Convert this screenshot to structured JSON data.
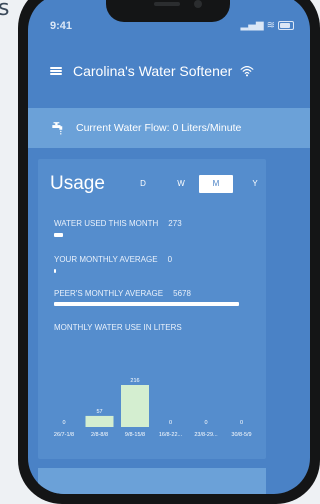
{
  "corner_glyph": "s",
  "status": {
    "time": "9:41"
  },
  "header": {
    "title": "Carolina's Water Softener"
  },
  "flow": {
    "text": "Current Water Flow: 0 Liters/Minute"
  },
  "usage": {
    "title": "Usage",
    "tabs": [
      {
        "label": "D",
        "active": false
      },
      {
        "label": "W",
        "active": false
      },
      {
        "label": "M",
        "active": true
      },
      {
        "label": "Y",
        "active": false
      }
    ],
    "stats": [
      {
        "label": "WATER USED THIS MONTH",
        "value": "273",
        "fraction": 0.05
      },
      {
        "label": "YOUR MONTHLY AVERAGE",
        "value": "0",
        "fraction": 0.0
      },
      {
        "label": "PEER'S MONTHLY AVERAGE",
        "value": "5678",
        "fraction": 1.0
      }
    ],
    "chart_heading": "MONTHLY WATER USE IN LITERS"
  },
  "chart_data": {
    "type": "bar",
    "title": "MONTHLY WATER USE IN LITERS",
    "categories": [
      "26/7-1/8",
      "2/8-8/8",
      "9/8-15/8",
      "16/8-22...",
      "23/8-29...",
      "30/8-5/9"
    ],
    "values": [
      0,
      57,
      216,
      0,
      0,
      0
    ],
    "ylim": [
      0,
      216
    ],
    "grid": false
  },
  "colors": {
    "screen": "#4a82c6",
    "flow_bar": "#6ba1d8",
    "card": "#558dcd",
    "bar": "#d4eed0"
  }
}
